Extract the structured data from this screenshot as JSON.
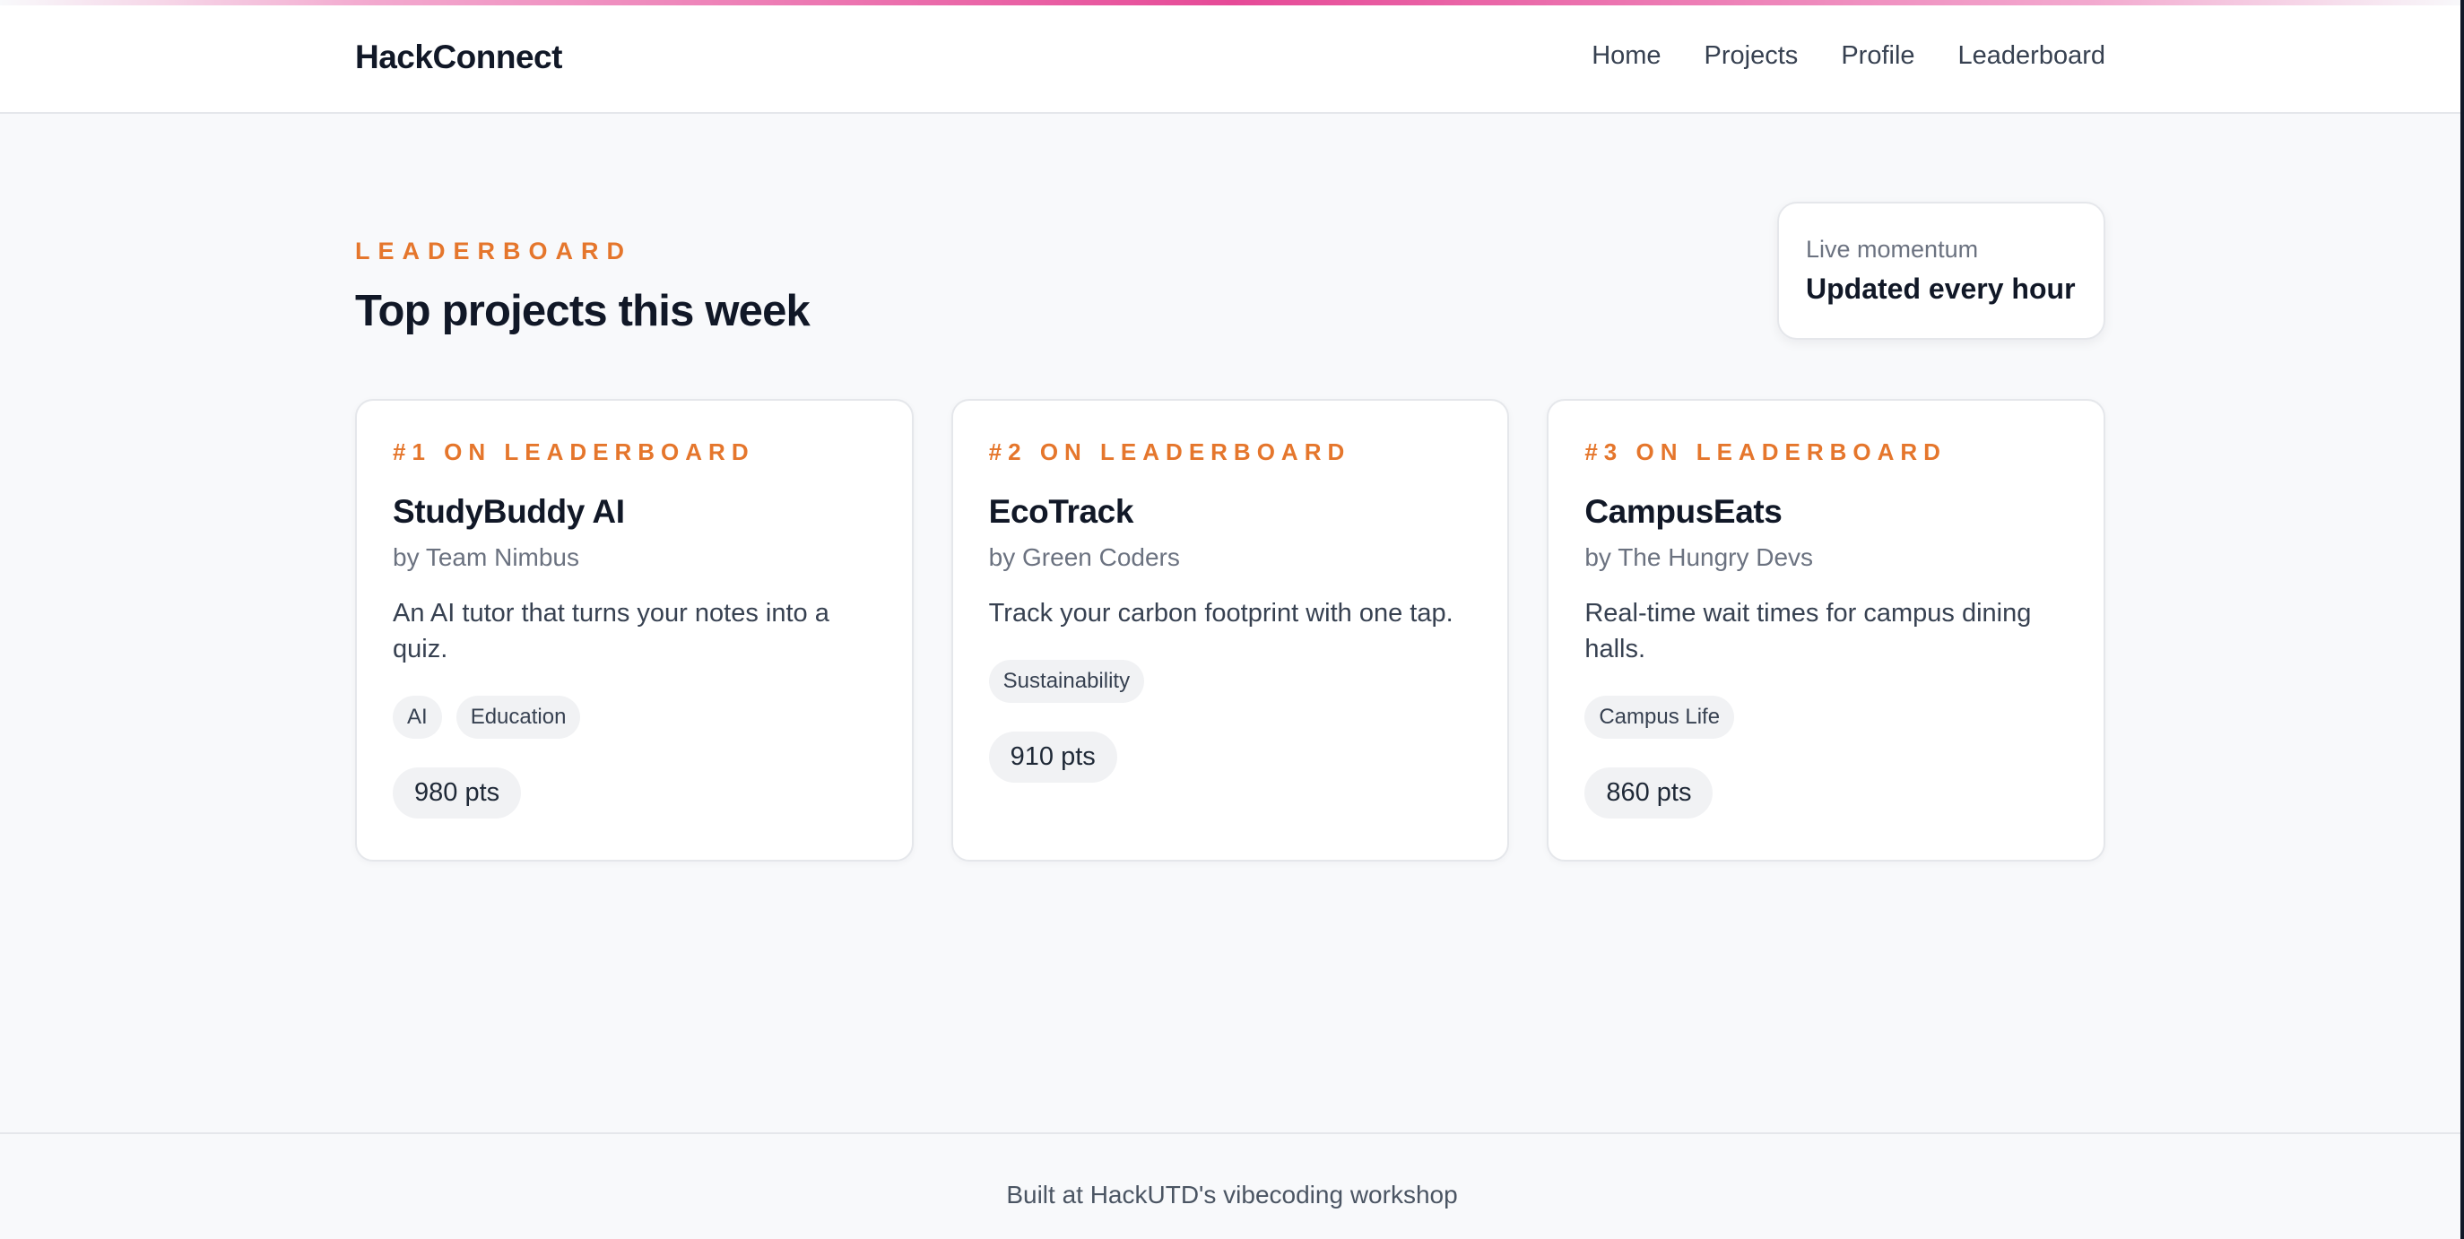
{
  "accent_color": "#e64a97",
  "highlight_color": "#e5762c",
  "header": {
    "brand": "HackConnect",
    "nav": [
      "Home",
      "Projects",
      "Profile",
      "Leaderboard"
    ]
  },
  "hero": {
    "eyebrow": "LEADERBOARD",
    "title": "Top projects this week",
    "momentum_label": "Live momentum",
    "momentum_value": "Updated every hour"
  },
  "projects": [
    {
      "rank": "#1 ON LEADERBOARD",
      "name": "StudyBuddy AI",
      "team": "by Team Nimbus",
      "description": "An AI tutor that turns your notes into a quiz.",
      "tags": [
        "AI",
        "Education"
      ],
      "points": "980 pts"
    },
    {
      "rank": "#2 ON LEADERBOARD",
      "name": "EcoTrack",
      "team": "by Green Coders",
      "description": "Track your carbon footprint with one tap.",
      "tags": [
        "Sustainability"
      ],
      "points": "910 pts"
    },
    {
      "rank": "#3 ON LEADERBOARD",
      "name": "CampusEats",
      "team": "by The Hungry Devs",
      "description": "Real-time wait times for campus dining halls.",
      "tags": [
        "Campus Life"
      ],
      "points": "860 pts"
    }
  ],
  "footer": {
    "text": "Built at HackUTD's vibecoding workshop"
  }
}
